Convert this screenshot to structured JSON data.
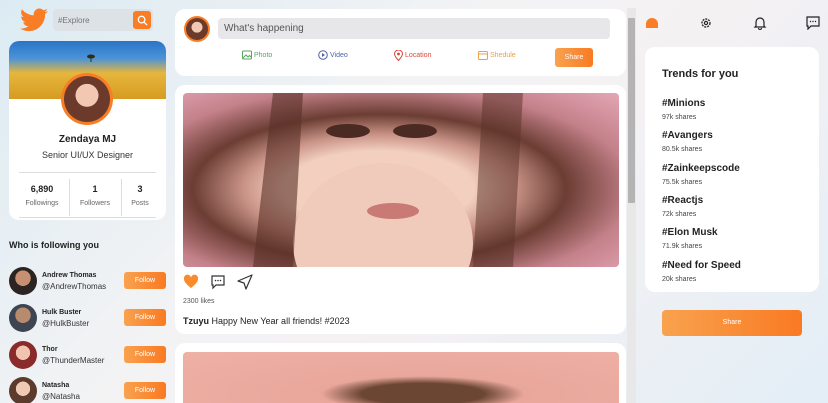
{
  "search": {
    "placeholder": "#Explore"
  },
  "profile": {
    "name": "Zendaya MJ",
    "role": "Senior UI/UX Designer",
    "stats": [
      {
        "value": "6,890",
        "label": "Followings"
      },
      {
        "value": "1",
        "label": "Followers"
      },
      {
        "value": "3",
        "label": "Posts"
      }
    ]
  },
  "followers": {
    "title": "Who is following you",
    "items": [
      {
        "name": "Andrew Thomas",
        "handle": "@AndrewThomas",
        "button": "Follow"
      },
      {
        "name": "Hulk Buster",
        "handle": "@HulkBuster",
        "button": "Follow"
      },
      {
        "name": "Thor",
        "handle": "@ThunderMaster",
        "button": "Follow"
      },
      {
        "name": "Natasha",
        "handle": "@Natasha",
        "button": "Follow"
      }
    ]
  },
  "composer": {
    "placeholder": "What's happening",
    "actions": [
      "Photo",
      "Video",
      "Location",
      "Shedule"
    ],
    "share": "Share"
  },
  "post": {
    "likes": "2300 likes",
    "author": "Tzuyu",
    "text": "Happy New Year all friends! #2023"
  },
  "trends": {
    "title": "Trends for you",
    "items": [
      {
        "tag": "#Minions",
        "count": "97k shares"
      },
      {
        "tag": "#Avangers",
        "count": "80.5k shares"
      },
      {
        "tag": "#Zainkeepscode",
        "count": "75.5k shares"
      },
      {
        "tag": "#Reactjs",
        "count": "72k shares"
      },
      {
        "tag": "#Elon Musk",
        "count": "71.9k shares"
      },
      {
        "tag": "#Need for Speed",
        "count": "20k shares"
      }
    ],
    "share": "Share"
  },
  "colors": {
    "accent": "#f97d24",
    "twitter": "#f97d24"
  }
}
